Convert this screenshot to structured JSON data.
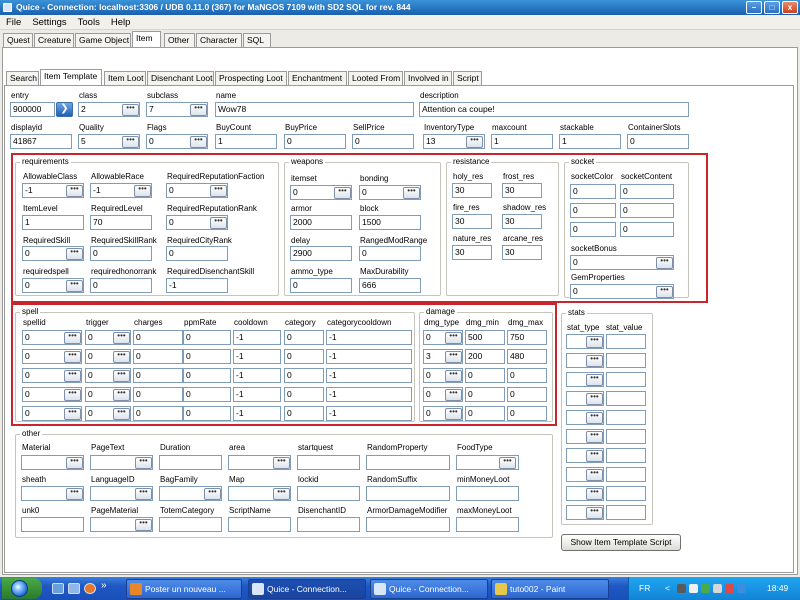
{
  "window": {
    "title": "Quice - Connection: localhost:3306 / UDB 0.11.0 (367) for MaNGOS 7109 with SD2 SQL for rev. 844"
  },
  "window_buttons": {
    "minimize": "–",
    "maximize": "□",
    "close": "x"
  },
  "menu": [
    "File",
    "Settings",
    "Tools",
    "Help"
  ],
  "main_tabs": [
    "Quest",
    "Creature",
    "Game Object",
    "Item",
    "Other",
    "Character",
    "SQL"
  ],
  "sub_tabs": [
    "Search",
    "Item Template",
    "Item Loot",
    "Disenchant Loot",
    "Prospecting Loot",
    "Enchantment",
    "Looted From",
    "Involved in",
    "Script"
  ],
  "go_glyph": "❯",
  "lookup_glyph": "•••",
  "top_fields": {
    "entry": {
      "label": "entry",
      "value": "900000"
    },
    "class": {
      "label": "class",
      "value": "2"
    },
    "subclass": {
      "label": "subclass",
      "value": "7"
    },
    "name": {
      "label": "name",
      "value": "Wow78"
    },
    "description": {
      "label": "description",
      "value": "Attention ca coupe!"
    },
    "displayid": {
      "label": "displayid",
      "value": "41867"
    },
    "quality": {
      "label": "Quality",
      "value": "5"
    },
    "flags": {
      "label": "Flags",
      "value": "0"
    },
    "buycount": {
      "label": "BuyCount",
      "value": "1"
    },
    "buyprice": {
      "label": "BuyPrice",
      "value": "0"
    },
    "sellprice": {
      "label": "SellPrice",
      "value": "0"
    },
    "inventorytype": {
      "label": "InventoryType",
      "value": "13"
    },
    "maxcount": {
      "label": "maxcount",
      "value": "1"
    },
    "stackable": {
      "label": "stackable",
      "value": "1"
    },
    "containerslots": {
      "label": "ContainerSlots",
      "value": "0"
    }
  },
  "requirements": {
    "label": "requirements",
    "allowableclass": {
      "label": "AllowableClass",
      "value": "-1"
    },
    "allowablerace": {
      "label": "AllowableRace",
      "value": "-1"
    },
    "requiredreputationfaction": {
      "label": "RequiredReputationFaction",
      "value": "0"
    },
    "itemlevel": {
      "label": "ItemLevel",
      "value": "1"
    },
    "requiredlevel": {
      "label": "RequiredLevel",
      "value": "70"
    },
    "requiredreputationrank": {
      "label": "RequiredReputationRank",
      "value": "0"
    },
    "requiredskill": {
      "label": "RequiredSkill",
      "value": "0"
    },
    "requiredskillrank": {
      "label": "RequiredSkillRank",
      "value": "0"
    },
    "requiredcityrank": {
      "label": "RequiredCityRank",
      "value": "0"
    },
    "requiredspell": {
      "label": "requiredspell",
      "value": "0"
    },
    "requiredhonorrank": {
      "label": "requiredhonorrank",
      "value": "0"
    },
    "requireddisenchantskill": {
      "label": "RequiredDisenchantSkill",
      "value": "-1"
    }
  },
  "weapons": {
    "label": "weapons",
    "itemset": {
      "label": "itemset",
      "value": "0"
    },
    "bonding": {
      "label": "bonding",
      "value": "0"
    },
    "armor": {
      "label": "armor",
      "value": "2000"
    },
    "block": {
      "label": "block",
      "value": "1500"
    },
    "delay": {
      "label": "delay",
      "value": "2900"
    },
    "rangedmodrange": {
      "label": "RangedModRange",
      "value": "0"
    },
    "ammo_type": {
      "label": "ammo_type",
      "value": "0"
    },
    "maxdurability": {
      "label": "MaxDurability",
      "value": "666"
    }
  },
  "resistance": {
    "label": "resistance",
    "holy_res": {
      "label": "holy_res",
      "value": "30"
    },
    "frost_res": {
      "label": "frost_res",
      "value": "30"
    },
    "fire_res": {
      "label": "fire_res",
      "value": "30"
    },
    "shadow_res": {
      "label": "shadow_res",
      "value": "30"
    },
    "nature_res": {
      "label": "nature_res",
      "value": "30"
    },
    "arcane_res": {
      "label": "arcane_res",
      "value": "30"
    }
  },
  "socket": {
    "label": "socket",
    "col_color": "socketColor",
    "col_content": "socketContent",
    "colors": [
      "0",
      "0",
      "0"
    ],
    "contents": [
      "0",
      "0",
      "0"
    ],
    "socketbonus": {
      "label": "socketBonus",
      "value": "0"
    },
    "gemproperties": {
      "label": "GemProperties",
      "value": "0"
    }
  },
  "spell": {
    "label": "spell",
    "headers": [
      "spellid",
      "trigger",
      "charges",
      "ppmRate",
      "cooldown",
      "category",
      "categorycooldown"
    ],
    "rows": [
      [
        "0",
        "0",
        "0",
        "0",
        "-1",
        "0",
        "-1"
      ],
      [
        "0",
        "0",
        "0",
        "0",
        "-1",
        "0",
        "-1"
      ],
      [
        "0",
        "0",
        "0",
        "0",
        "-1",
        "0",
        "-1"
      ],
      [
        "0",
        "0",
        "0",
        "0",
        "-1",
        "0",
        "-1"
      ],
      [
        "0",
        "0",
        "0",
        "0",
        "-1",
        "0",
        "-1"
      ]
    ]
  },
  "damage": {
    "label": "damage",
    "headers": [
      "dmg_type",
      "dmg_min",
      "dmg_max"
    ],
    "rows": [
      [
        "0",
        "500",
        "750"
      ],
      [
        "3",
        "200",
        "480"
      ],
      [
        "0",
        "0",
        "0"
      ],
      [
        "0",
        "0",
        "0"
      ],
      [
        "0",
        "0",
        "0"
      ]
    ]
  },
  "stats": {
    "label": "stats",
    "headers": [
      "stat_type",
      "stat_value"
    ],
    "rows": [
      [
        "",
        ""
      ],
      [
        "",
        ""
      ],
      [
        "",
        ""
      ],
      [
        "",
        ""
      ],
      [
        "",
        ""
      ],
      [
        "",
        ""
      ],
      [
        "",
        ""
      ],
      [
        "",
        ""
      ],
      [
        "",
        ""
      ],
      [
        "",
        ""
      ]
    ]
  },
  "other": {
    "label": "other",
    "material": {
      "label": "Material",
      "value": ""
    },
    "pagetext": {
      "label": "PageText",
      "value": ""
    },
    "duration": {
      "label": "Duration",
      "value": ""
    },
    "area": {
      "label": "area",
      "value": ""
    },
    "startquest": {
      "label": "startquest",
      "value": ""
    },
    "randomproperty": {
      "label": "RandomProperty",
      "value": ""
    },
    "foodtype": {
      "label": "FoodType",
      "value": ""
    },
    "sheath": {
      "label": "sheath",
      "value": ""
    },
    "languageid": {
      "label": "LanguageID",
      "value": ""
    },
    "bagfamily": {
      "label": "BagFamily",
      "value": ""
    },
    "map": {
      "label": "Map",
      "value": ""
    },
    "lockid": {
      "label": "lockid",
      "value": ""
    },
    "randomsuffix": {
      "label": "RandomSuffix",
      "value": ""
    },
    "minmoneyloot": {
      "label": "minMoneyLoot",
      "value": ""
    },
    "unk0": {
      "label": "unk0",
      "value": ""
    },
    "pagematerial": {
      "label": "PageMaterial",
      "value": ""
    },
    "totemcategory": {
      "label": "TotemCategory",
      "value": ""
    },
    "scriptname": {
      "label": "ScriptName",
      "value": ""
    },
    "disenchantid": {
      "label": "DisenchantID",
      "value": ""
    },
    "armordamagemodifier": {
      "label": "ArmorDamageModifier",
      "value": ""
    },
    "maxmoneyloot": {
      "label": "maxMoneyLoot",
      "value": ""
    }
  },
  "show_script_button": "Show Item Template Script",
  "taskbar": {
    "tasks": [
      {
        "label": "Poster un nouveau ...",
        "icon_color": "#e8862a"
      },
      {
        "label": "Quice - Connection...",
        "icon_color": "#d9e6f5"
      },
      {
        "label": "Quice - Connection...",
        "icon_color": "#d9e6f5"
      },
      {
        "label": "tuto002 - Paint",
        "icon_color": "#e6c84a"
      }
    ],
    "arrows": "»",
    "language": "FR",
    "tray_arrow": "<",
    "clock": "18:49"
  }
}
